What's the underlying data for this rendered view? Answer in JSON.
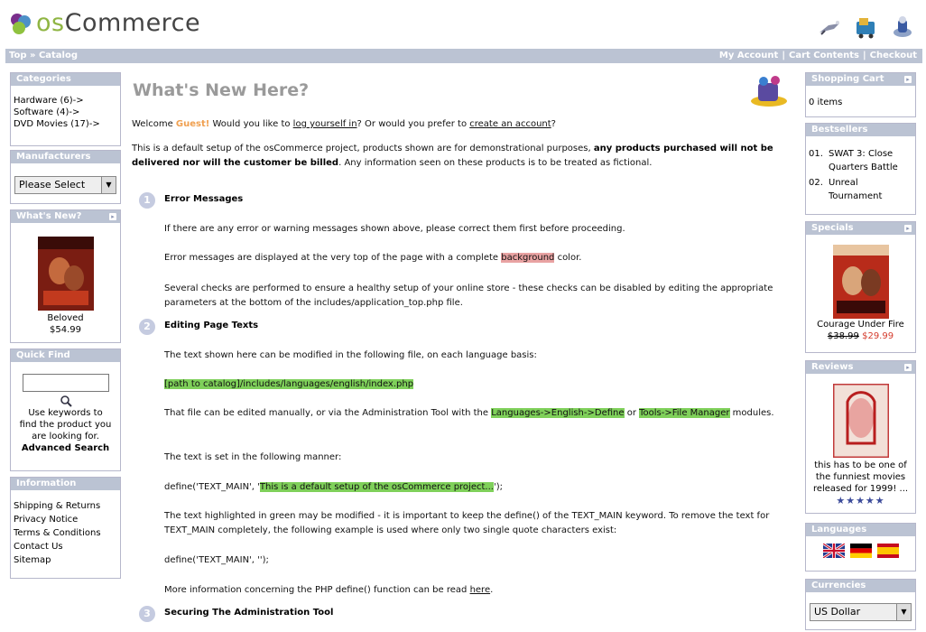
{
  "header": {
    "logo_os": "os",
    "logo_commerce": "Commerce"
  },
  "navbar": {
    "breadcrumb": "Top » Catalog",
    "links": [
      "My Account",
      "Cart Contents",
      "Checkout"
    ]
  },
  "left": {
    "categories": {
      "title": "Categories",
      "items": [
        "Hardware (6)->",
        "Software (4)->",
        "DVD Movies (17)->"
      ]
    },
    "manufacturers": {
      "title": "Manufacturers",
      "select_value": "Please Select"
    },
    "whats_new": {
      "title": "What's New?",
      "product_name": "Beloved",
      "price": "$54.99"
    },
    "quick_find": {
      "title": "Quick Find",
      "search_value": "",
      "help_text": "Use keywords to find the product you are looking for.",
      "advanced": "Advanced Search"
    },
    "information": {
      "title": "Information",
      "items": [
        "Shipping & Returns",
        "Privacy Notice",
        "Terms & Conditions",
        "Contact Us",
        "Sitemap"
      ]
    }
  },
  "main": {
    "title": "What's New Here?",
    "welcome": {
      "a": "Welcome ",
      "guest": "Guest!",
      "b": " Would you like to ",
      "login": "log yourself in",
      "c": "? Or would you prefer to ",
      "create": "create an account",
      "d": "?"
    },
    "intro": {
      "a": "This is a default setup of the osCommerce project, products shown are for demonstrational purposes, ",
      "bold": "any products purchased will not be delivered nor will the customer be billed",
      "b": ". Any information seen on these products is to be treated as fictional."
    },
    "sec1": {
      "num": "1",
      "heading": "Error Messages",
      "p1": "If there are any error or warning messages shown above, please correct them first before proceeding.",
      "p2a": "Error messages are displayed at the very top of the page with a complete ",
      "p2hl": "background",
      "p2b": " color.",
      "p3": "Several checks are performed to ensure a healthy setup of your online store - these checks can be disabled by editing the appropriate parameters at the bottom of the includes/application_top.php file."
    },
    "sec2": {
      "num": "2",
      "heading": "Editing Page Texts",
      "p1": "The text shown here can be modified in the following file, on each language basis:",
      "path": "[path to catalog]/includes/languages/english/index.php",
      "p2a": "That file can be edited manually, or via the Administration Tool with the ",
      "p2hl1": "Languages->English->Define",
      "p2b": " or ",
      "p2hl2": "Tools->File Manager",
      "p2c": " modules.",
      "p3": "The text is set in the following manner:",
      "code1a": "define('TEXT_MAIN', '",
      "code1hl": "This is a default setup of the osCommerce project...",
      "code1b": "');",
      "p4": "The text highlighted in green may be modified - it is important to keep the define() of the TEXT_MAIN keyword. To remove the text for TEXT_MAIN completely, the following example is used where only two single quote characters exist:",
      "code2": "define('TEXT_MAIN', '');",
      "p5a": "More information concerning the PHP define() function can be read ",
      "p5link": "here",
      "p5b": "."
    },
    "sec3": {
      "num": "3",
      "heading": "Securing The Administration Tool"
    }
  },
  "right": {
    "cart": {
      "title": "Shopping Cart",
      "text": "0 items"
    },
    "bestsellers": {
      "title": "Bestsellers",
      "items": [
        {
          "n": "01.",
          "t": "SWAT 3: Close Quarters Battle"
        },
        {
          "n": "02.",
          "t": "Unreal Tournament"
        }
      ]
    },
    "specials": {
      "title": "Specials",
      "name": "Courage Under Fire",
      "old_price": "$38.99",
      "new_price": "$29.99"
    },
    "reviews": {
      "title": "Reviews",
      "text": "this has to be one of the funniest movies released for 1999! ...",
      "stars": "★★★★★"
    },
    "languages": {
      "title": "Languages"
    },
    "currencies": {
      "title": "Currencies",
      "select_value": "US Dollar"
    }
  },
  "colors": {
    "box_header": "#bbc3d3",
    "highlight": "#7fd05a",
    "guest": "#f0a050",
    "special_price": "#d43b2c"
  },
  "icons": [
    "logo-icon",
    "my-account-icon",
    "cart-icon",
    "checkout-icon",
    "search-icon",
    "whats-new-illustration"
  ]
}
